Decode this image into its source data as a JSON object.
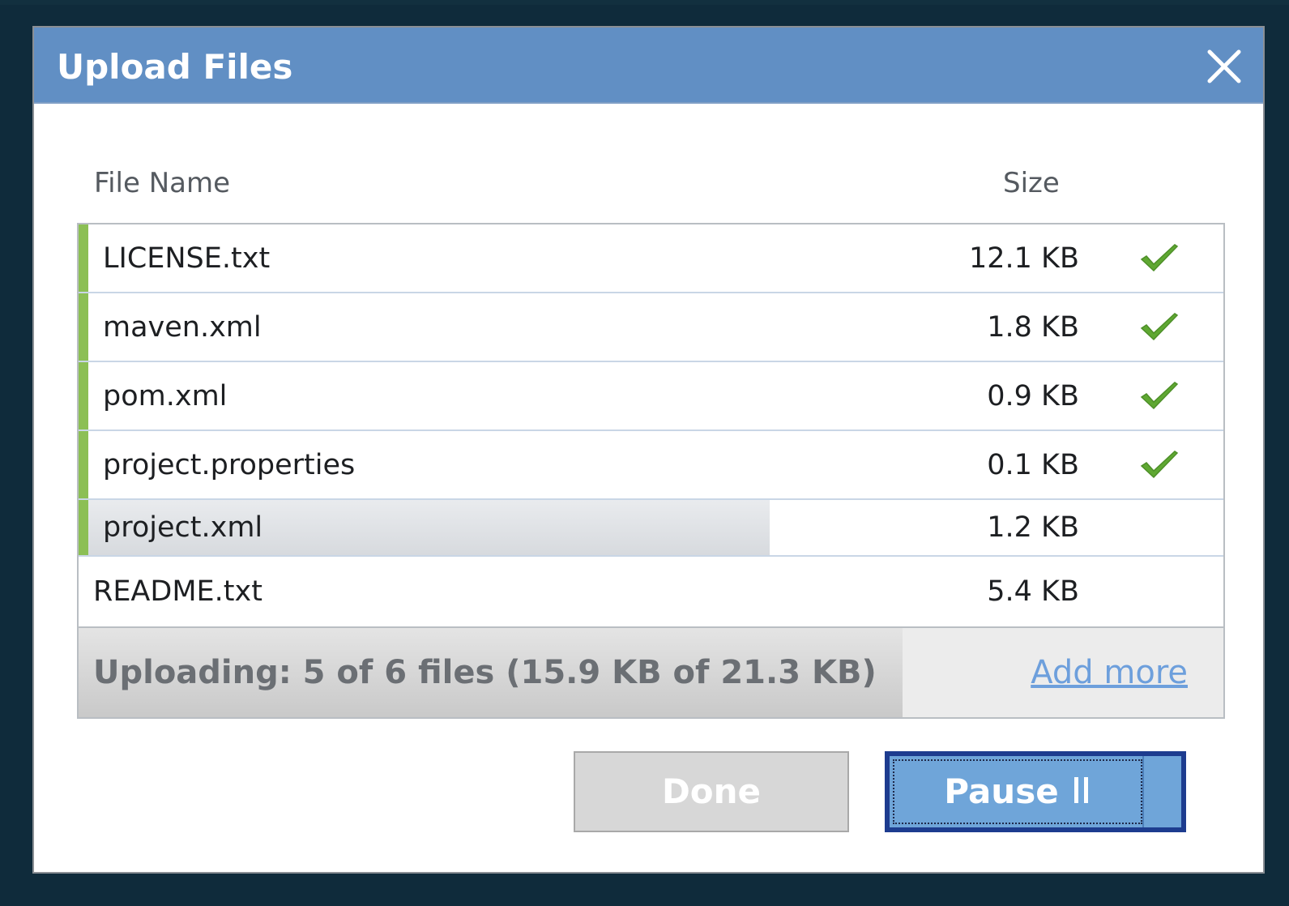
{
  "dialog": {
    "title": "Upload Files",
    "close_icon": "close-icon"
  },
  "columns": {
    "name": "File Name",
    "size": "Size"
  },
  "files": [
    {
      "name": "LICENSE.txt",
      "size": "12.1 KB",
      "status": "done"
    },
    {
      "name": "maven.xml",
      "size": "1.8 KB",
      "status": "done"
    },
    {
      "name": "pom.xml",
      "size": "0.9 KB",
      "status": "done"
    },
    {
      "name": "project.properties",
      "size": "0.1 KB",
      "status": "done"
    },
    {
      "name": "project.xml",
      "size": "1.2 KB",
      "status": "uploading",
      "progress": 0.6
    },
    {
      "name": "README.txt",
      "size": "5.4 KB",
      "status": "pending"
    }
  ],
  "status": {
    "text": "Uploading: 5 of 6 files (15.9 KB of 21.3 KB)",
    "progress": 0.72,
    "add_more_label": "Add more"
  },
  "buttons": {
    "done_label": "Done",
    "pause_label": "Pause"
  },
  "colors": {
    "titlebar": "#618fc4",
    "complete_bar": "#8cbf55",
    "check": "#5fa832",
    "link": "#6d9fdc",
    "pause_button": "#6fa5d9",
    "pause_border": "#1d3c8f"
  }
}
